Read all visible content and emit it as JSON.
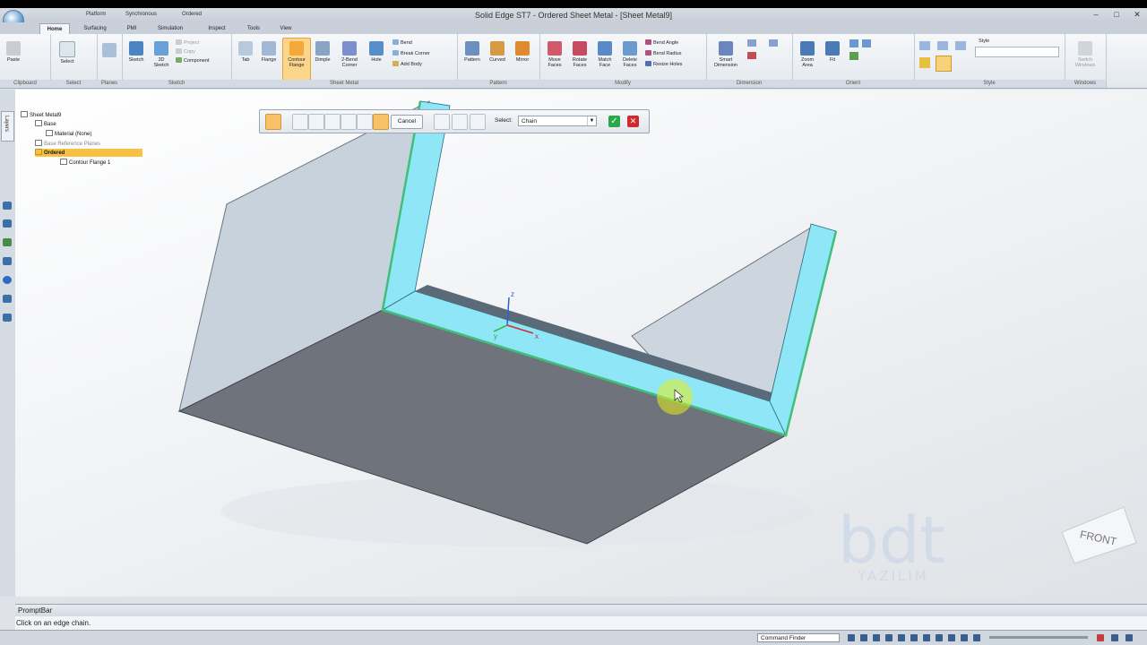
{
  "window": {
    "title": "Solid Edge ST7 - Ordered Sheet Metal - [Sheet Metal9]",
    "qat_items": [
      "Platform",
      "Synchronous",
      "Ordered"
    ]
  },
  "tabs": [
    "Home",
    "Surfacing",
    "PMI",
    "Simulation",
    "Inspect",
    "Tools",
    "View"
  ],
  "active_tab": "Home",
  "ribbon": {
    "groups": [
      "Clipboard",
      "Select",
      "Planes",
      "Sketch",
      "Sheet Metal",
      "Pattern",
      "Modify",
      "Dimension",
      "Orient",
      "Style",
      "Windows"
    ],
    "clipboard": {
      "paste": "Paste"
    },
    "select": {
      "select": "Select"
    },
    "sketch": {
      "sketch": "Sketch",
      "sketch3d": "3D Sketch",
      "project": "Project",
      "copy": "Copy",
      "component": "Component"
    },
    "sheet_metal": {
      "tab": "Tab",
      "flange": "Flange",
      "contour_flange": "Contour Flange",
      "dimple": "Dimple",
      "bend_corner": "2-Bend Corner",
      "hole": "Hole",
      "bend": "Bend",
      "break_corner": "Break Corner",
      "add_body": "Add Body"
    },
    "pattern": {
      "pattern": "Pattern",
      "curved": "Curved",
      "mirror": "Mirror"
    },
    "modify": {
      "move_faces": "Move Faces",
      "rotate_faces": "Rotate Faces",
      "match_face": "Match Face",
      "delete_faces": "Delete Faces",
      "bend_angle": "Bend Angle",
      "bend_radius": "Bend Radius",
      "resize_holes": "Resize Holes"
    },
    "dimension": {
      "smart": "Smart Dimension"
    },
    "orient": {
      "zoom_area": "Zoom Area",
      "fit": "Fit"
    },
    "style": {
      "label": "Style"
    },
    "windows": {
      "switch": "Switch Windows"
    }
  },
  "tree": {
    "root": "Sheet Metal9",
    "items": [
      "Base",
      "Material (None)",
      "Base Reference Planes",
      "Ordered",
      "Contour Flange 1"
    ]
  },
  "command_bar": {
    "cancel": "Cancel",
    "select_label": "Select:",
    "select_value": "Chain",
    "dropdown_arrow": "▼",
    "ok_glyph": "✓",
    "close_glyph": "✕"
  },
  "triad": {
    "z": "z",
    "y": "y",
    "x": "x"
  },
  "view_cube": {
    "face": "FRONT"
  },
  "watermark": {
    "logo": "bdt",
    "sub": "YAZILIM"
  },
  "promptbar": {
    "title": "PromptBar",
    "message": "Click on an edge chain."
  },
  "statusbar": {
    "command_finder": "Command Finder"
  },
  "colors": {
    "highlight": "#8ee6f7",
    "edge": "#3fbf7a",
    "base_face": "#6f747c",
    "wall": "#c9d3dd",
    "cursor": "#e6ee1a"
  }
}
